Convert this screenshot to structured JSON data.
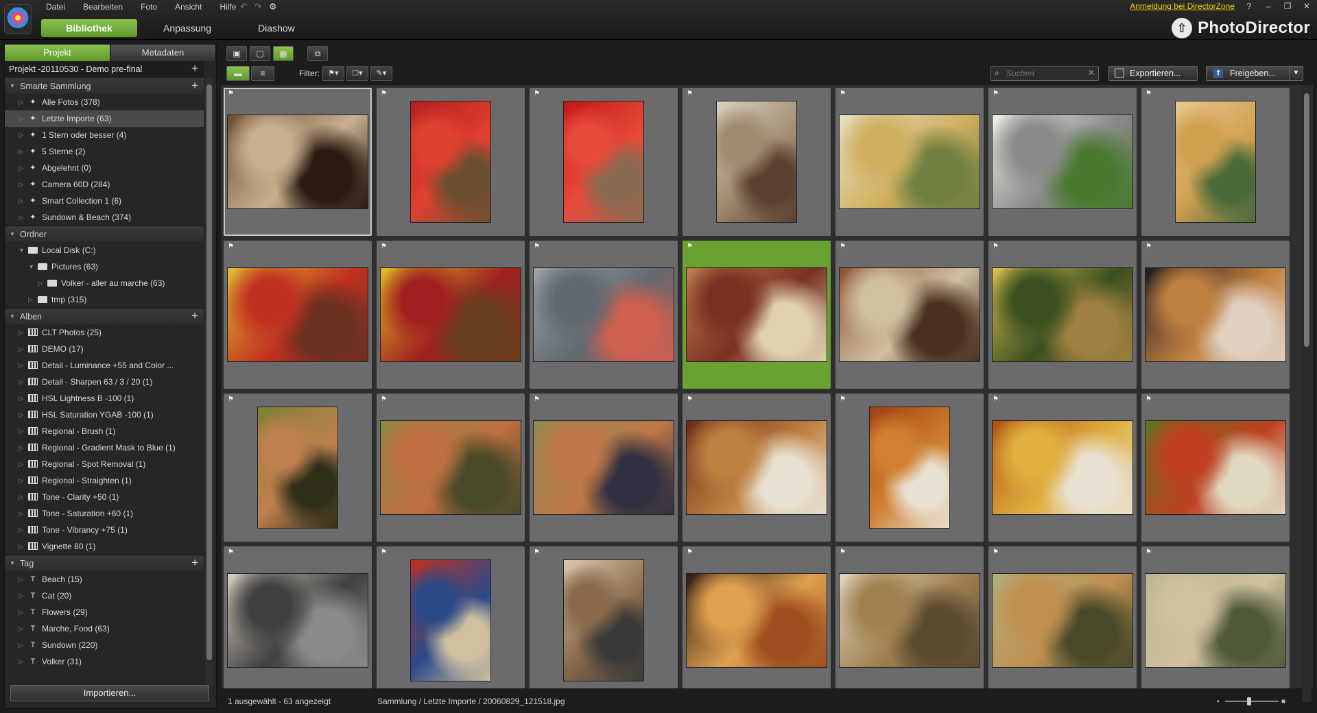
{
  "menu": [
    "Datei",
    "Bearbeiten",
    "Foto",
    "Ansicht",
    "Hilfe"
  ],
  "main_tabs": [
    "Bibliothek",
    "Anpassung",
    "Diashow"
  ],
  "header": {
    "directorzone_link": "Anmeldung bei DirectorZone",
    "help": "?",
    "brand": "PhotoDirector"
  },
  "left_tabs": [
    "Projekt",
    "Metadaten"
  ],
  "project_name": "Projekt -20110530 - Demo pre-final",
  "sections": {
    "smart": {
      "title": "Smarte Sammlung",
      "items": [
        "Alle Fotos (378)",
        "Letzte Importe (63)",
        "1 Stern oder besser (4)",
        "5 Sterne (2)",
        "Abgelehnt (0)",
        "Camera 60D (284)",
        "Smart Collection 1 (6)",
        "Sundown & Beach (374)"
      ]
    },
    "folders": {
      "title": "Ordner",
      "items": [
        "Local Disk (C:)",
        "Pictures (63)",
        "Volker - aller au marche (63)",
        "tmp (315)"
      ]
    },
    "albums": {
      "title": "Alben",
      "items": [
        "CLT Photos (25)",
        "DEMO (17)",
        "Detail - Luminance +55 and Color ...",
        "Detail - Sharpen 63 / 3 / 20 (1)",
        "HSL Lightness B -100 (1)",
        "HSL Saturation YGAB -100 (1)",
        "Regional - Brush (1)",
        "Regional - Gradient Mask to Blue (1)",
        "Regional - Spot Removal (1)",
        "Regional - Straighten (1)",
        "Tone - Clarity +50 (1)",
        "Tone - Saturation +60 (1)",
        "Tone - Vibrancy +75 (1)",
        "Vignette 80 (1)"
      ]
    },
    "tags": {
      "title": "Tag",
      "items": [
        "Beach (15)",
        "Cat (20)",
        "Flowers (29)",
        "Marche, Food (63)",
        "Sundown (220)",
        "Volker (31)"
      ]
    }
  },
  "import_button": "Importieren...",
  "filter_label": "Filter:",
  "search": {
    "placeholder": "Suchen"
  },
  "export_button": "Exportieren...",
  "share_button": "Freigeben...",
  "status": {
    "left": "1 ausgewählt - 63 angezeigt",
    "path": "Sammlung / Letzte Importe / 20060829_121518.jpg"
  },
  "thumbnails": [
    {
      "orient": "land",
      "c1": "#6a4a2a",
      "c2": "#c8b090",
      "c3": "#2a1a10"
    },
    {
      "orient": "port",
      "c1": "#b02020",
      "c2": "#e04030",
      "c3": "#6a5030"
    },
    {
      "orient": "port",
      "c1": "#c01818",
      "c2": "#e84a3a",
      "c3": "#8a6a50"
    },
    {
      "orient": "port",
      "c1": "#d8d0c0",
      "c2": "#a08a70",
      "c3": "#5a4030"
    },
    {
      "orient": "land",
      "c1": "#e8e0c8",
      "c2": "#d0b060",
      "c3": "#708040"
    },
    {
      "orient": "land",
      "c1": "#f0eee8",
      "c2": "#8a8a8a",
      "c3": "#4a7a30"
    },
    {
      "orient": "port",
      "c1": "#e8c890",
      "c2": "#d0a050",
      "c3": "#4a6a3a"
    },
    {
      "orient": "land",
      "c1": "#e0c030",
      "c2": "#c03020",
      "c3": "#6a3020"
    },
    {
      "orient": "land",
      "c1": "#e0c020",
      "c2": "#a02020",
      "c3": "#6a4020"
    },
    {
      "orient": "land",
      "c1": "#a0a4a8",
      "c2": "#606870",
      "c3": "#d06050"
    },
    {
      "orient": "land",
      "c1": "#c08050",
      "c2": "#7a3020",
      "c3": "#e0d0b0"
    },
    {
      "orient": "land",
      "c1": "#8a5030",
      "c2": "#d0c0a0",
      "c3": "#4a3020"
    },
    {
      "orient": "land",
      "c1": "#e0c050",
      "c2": "#3a5020",
      "c3": "#a08040"
    },
    {
      "orient": "land",
      "c1": "#1a1a20",
      "c2": "#c08040",
      "c3": "#e0d0c0"
    },
    {
      "orient": "port",
      "c1": "#7a8030",
      "c2": "#c08050",
      "c3": "#30301a"
    },
    {
      "orient": "land",
      "c1": "#8a8a40",
      "c2": "#c07040",
      "c3": "#4a4a2a"
    },
    {
      "orient": "land",
      "c1": "#8a8a50",
      "c2": "#c07848",
      "c3": "#303040"
    },
    {
      "orient": "land",
      "c1": "#6a2a1a",
      "c2": "#c08040",
      "c3": "#e8e0d0"
    },
    {
      "orient": "port",
      "c1": "#a04010",
      "c2": "#d08030",
      "c3": "#e8e0d0"
    },
    {
      "orient": "land",
      "c1": "#b05010",
      "c2": "#e0b040",
      "c3": "#e8e0d0"
    },
    {
      "orient": "land",
      "c1": "#5a7a20",
      "c2": "#c04020",
      "c3": "#e0d8c0"
    },
    {
      "orient": "land",
      "c1": "#d8d0c0",
      "c2": "#404040",
      "c3": "#8a8a8a"
    },
    {
      "orient": "port",
      "c1": "#c03020",
      "c2": "#2a4a8a",
      "c3": "#d0c0a0"
    },
    {
      "orient": "port",
      "c1": "#d8c8b0",
      "c2": "#8a6a4a",
      "c3": "#3a3a3a"
    },
    {
      "orient": "land",
      "c1": "#2a1a10",
      "c2": "#e0a050",
      "c3": "#a05020"
    },
    {
      "orient": "land",
      "c1": "#e0d8c0",
      "c2": "#a08050",
      "c3": "#5a4a30"
    },
    {
      "orient": "land",
      "c1": "#b0b080",
      "c2": "#c09050",
      "c3": "#4a4a2a"
    },
    {
      "orient": "land",
      "c1": "#b8b890",
      "c2": "#d0c0a0",
      "c3": "#505a3a"
    }
  ],
  "selected_index": 0,
  "focus_index": 10
}
